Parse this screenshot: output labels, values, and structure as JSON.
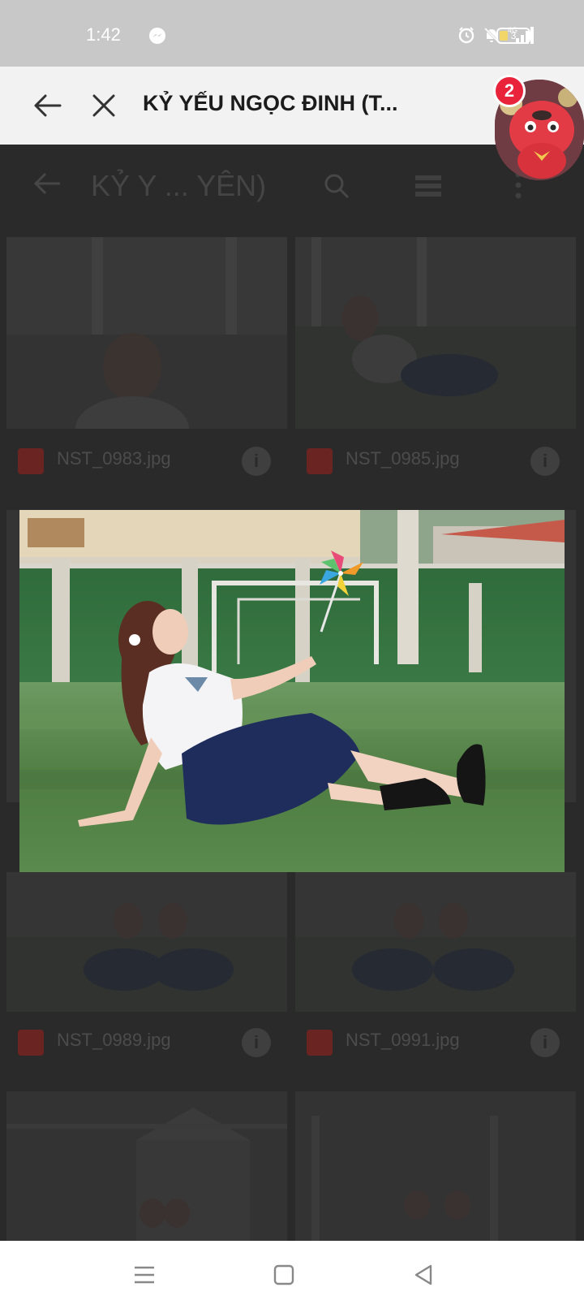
{
  "status_bar": {
    "time": "1:42",
    "battery_level": "3",
    "icons": [
      "messenger-icon",
      "alarm-icon",
      "mute-icon",
      "4g-signal-icon",
      "battery-icon"
    ]
  },
  "app_bar": {
    "title": "KỶ YẾU NGỌC ĐINH (T...",
    "back_icon": "arrow-left-icon",
    "close_icon": "close-icon"
  },
  "chat_head": {
    "badge_count": "2",
    "avatar": "red-mascot-avatar"
  },
  "drive_view": {
    "title": "KỶ Y ... YÊN)",
    "files": [
      {
        "name": "NST_0983.jpg"
      },
      {
        "name": "NST_0985.jpg"
      },
      {
        "name": "NST_0989.jpg"
      },
      {
        "name": "NST_0991.jpg"
      }
    ],
    "info_glyph": "i"
  },
  "photo_preview": {
    "subject": "student-with-pinwheel-on-field-photo"
  },
  "colors": {
    "status_bar_bg": "#c8c8c8",
    "app_bar_bg": "#f2f2f2",
    "badge": "#e8233a",
    "field_green": "#4f7d42",
    "skirt_navy": "#1f2d5c"
  },
  "nav_bar": {
    "icons": [
      "recents-menu-icon",
      "home-square-icon",
      "back-triangle-icon"
    ]
  }
}
